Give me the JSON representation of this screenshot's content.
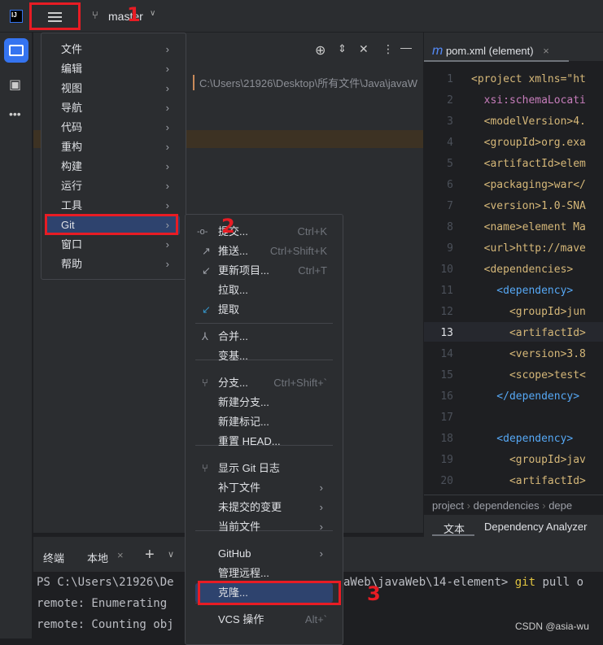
{
  "topbar": {
    "branch": "master",
    "logo": "IJ"
  },
  "annotations": [
    "1",
    "2",
    "3"
  ],
  "project_panel": {
    "path": "C:\\Users\\21926\\Desktop\\所有文件\\Java\\javaW"
  },
  "main_menu": [
    {
      "label": "文件"
    },
    {
      "label": "编辑"
    },
    {
      "label": "视图"
    },
    {
      "label": "导航"
    },
    {
      "label": "代码"
    },
    {
      "label": "重构"
    },
    {
      "label": "构建"
    },
    {
      "label": "运行"
    },
    {
      "label": "工具"
    },
    {
      "label": "Git",
      "selected": true
    },
    {
      "label": "窗口"
    },
    {
      "label": "帮助"
    }
  ],
  "git_menu": [
    {
      "label": "提交...",
      "shortcut": "Ctrl+K",
      "icon": "commit-icon"
    },
    {
      "label": "推送...",
      "shortcut": "Ctrl+Shift+K",
      "icon": "push-arrow-icon"
    },
    {
      "label": "更新项目...",
      "shortcut": "Ctrl+T",
      "icon": "update-arrow-icon"
    },
    {
      "label": "拉取..."
    },
    {
      "label": "提取",
      "icon": "fetch-icon"
    },
    {
      "label": "合并...",
      "icon": "merge-icon"
    },
    {
      "label": "变基..."
    },
    {
      "label": "分支...",
      "shortcut": "Ctrl+Shift+`",
      "icon": "branch-icon"
    },
    {
      "label": "新建分支..."
    },
    {
      "label": "新建标记..."
    },
    {
      "label": "重置 HEAD..."
    },
    {
      "label": "显示 Git 日志",
      "icon": "git-log-icon"
    },
    {
      "label": "补丁文件",
      "submenu": true
    },
    {
      "label": "未提交的变更",
      "submenu": true
    },
    {
      "label": "当前文件",
      "submenu": true
    },
    {
      "label": "GitHub",
      "submenu": true
    },
    {
      "label": "管理远程..."
    },
    {
      "label": "克隆...",
      "selected": true
    },
    {
      "label": "VCS 操作",
      "shortcut": "Alt+`"
    }
  ],
  "editor": {
    "tab": "pom.xml (element)",
    "lines": [
      {
        "n": "1",
        "text": "<project xmlns=\"ht"
      },
      {
        "n": "2",
        "text": "  xsi:schemaLocati"
      },
      {
        "n": "3",
        "text": "  <modelVersion>4."
      },
      {
        "n": "4",
        "text": "  <groupId>org.exa"
      },
      {
        "n": "5",
        "text": "  <artifactId>elem"
      },
      {
        "n": "6",
        "text": "  <packaging>war</"
      },
      {
        "n": "7",
        "text": "  <version>1.0-SNA"
      },
      {
        "n": "8",
        "text": "  <name>element Ma"
      },
      {
        "n": "9",
        "text": "  <url>http://mave"
      },
      {
        "n": "10",
        "text": "  <dependencies>"
      },
      {
        "n": "11",
        "text": "    <dependency>"
      },
      {
        "n": "12",
        "text": "      <groupId>jun"
      },
      {
        "n": "13",
        "text": "      <artifactId>"
      },
      {
        "n": "14",
        "text": "      <version>3.8"
      },
      {
        "n": "15",
        "text": "      <scope>test<"
      },
      {
        "n": "16",
        "text": "    </dependency>"
      },
      {
        "n": "17",
        "text": ""
      },
      {
        "n": "18",
        "text": "    <dependency>"
      },
      {
        "n": "19",
        "text": "      <groupId>jav"
      },
      {
        "n": "20",
        "text": "      <artifactId>"
      }
    ],
    "breadcrumb": [
      "project",
      "dependencies",
      "depe"
    ],
    "bottom_tabs": [
      "文本",
      "Dependency Analyzer"
    ]
  },
  "terminal": {
    "title": "终端",
    "tab": "本地",
    "lines": [
      "PS C:\\Users\\21926\\De",
      "remote: Enumerating",
      "remote: Counting obj"
    ],
    "line1_tail": "vaWeb\\javaWeb\\14-element> ",
    "cmd": "git",
    "cmd_rest": " pull o",
    "line3_tail": "."
  },
  "watermark": "CSDN @asia-wu",
  "colors": {
    "accent": "#3574f0",
    "selection": "#2e436e",
    "annotation": "#e81c24"
  }
}
